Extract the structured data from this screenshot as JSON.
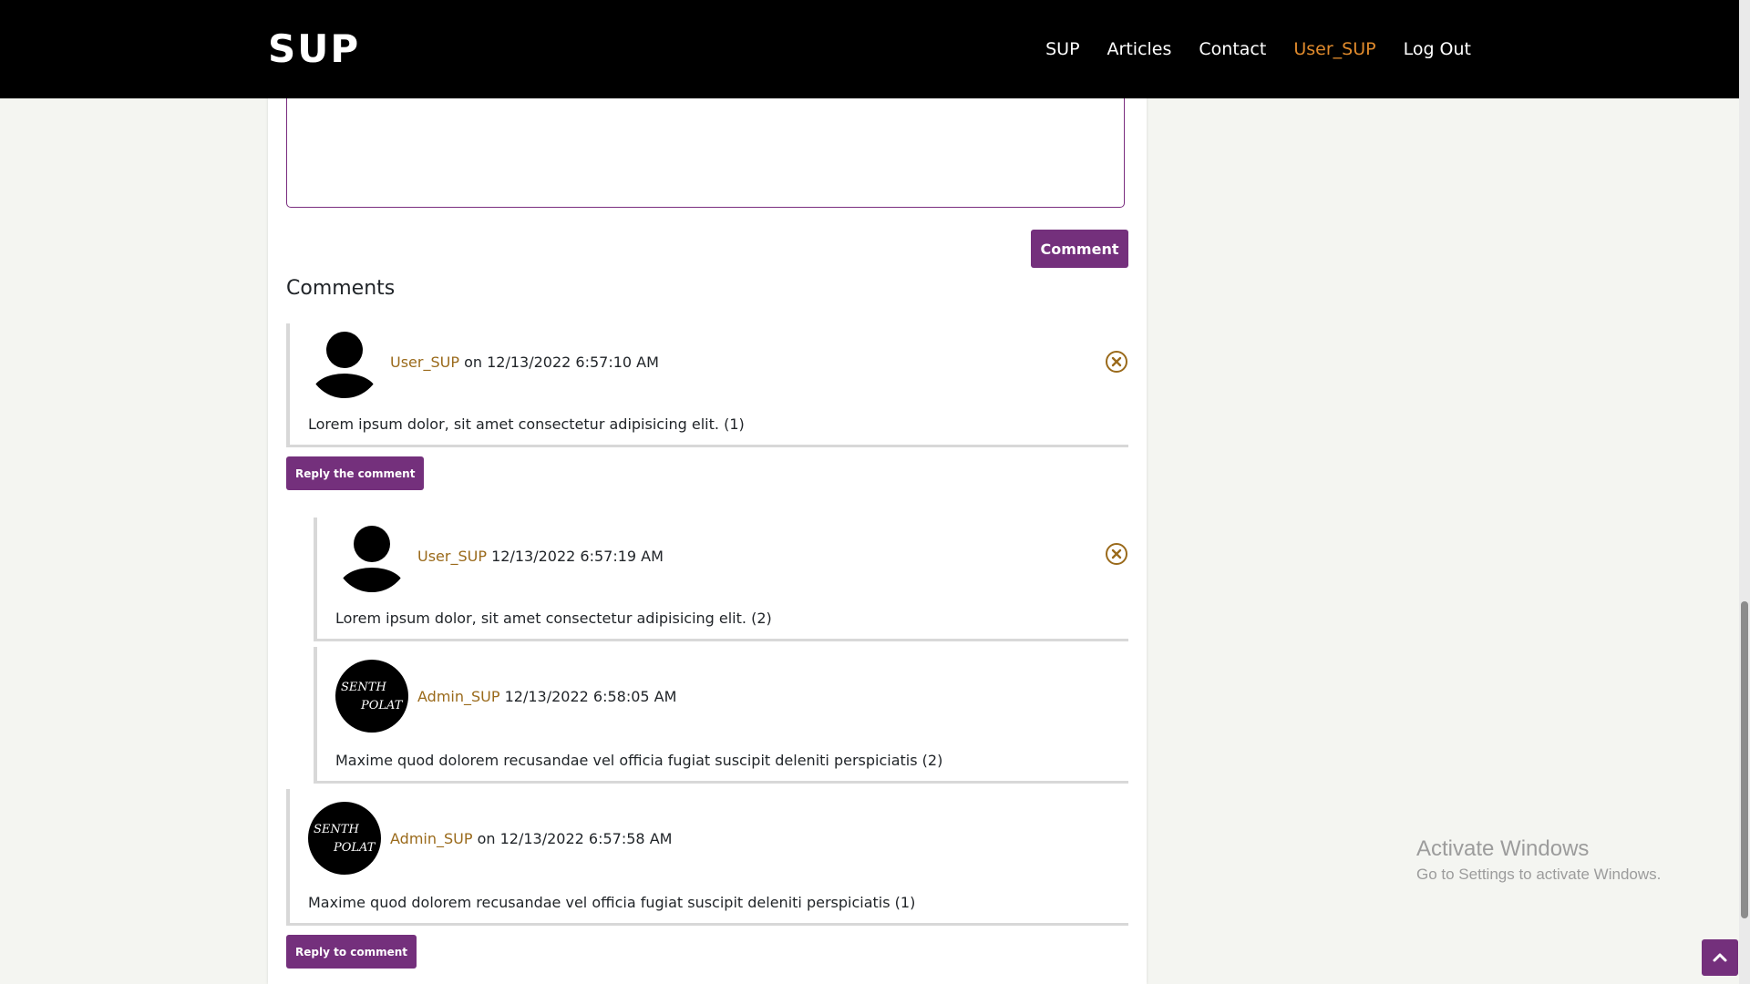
{
  "nav": {
    "brand": "SUP",
    "links": [
      "SUP",
      "Articles",
      "Contact",
      "User_SUP",
      "Log Out"
    ],
    "active_index": 3
  },
  "form": {
    "comment_button": "Comment"
  },
  "comments_title": "Comments",
  "comments": [
    {
      "author": "User_SUP",
      "date": "on 12/13/2022 6:57:10 AM",
      "text": "Lorem ipsum dolor, sit amet consectetur adipisicing elit. (1)",
      "reply_button": "Reply the comment",
      "avatar": "user-silhouette",
      "replies": [
        {
          "author": "User_SUP",
          "date": "12/13/2022 6:57:19 AM",
          "text": "Lorem ipsum dolor, sit amet consectetur adipisicing elit. (2)",
          "avatar": "user-silhouette"
        },
        {
          "author": "Admin_SUP",
          "date": "12/13/2022 6:58:05 AM",
          "text": "Maxime quod dolorem recusandae vel officia fugiat suscipit deleniti perspiciatis (2)",
          "avatar": "admin-logo"
        }
      ]
    },
    {
      "author": "Admin_SUP",
      "date": "on 12/13/2022 6:57:58 AM",
      "text": "Maxime quod dolorem recusandae vel officia fugiat suscipit deleniti perspiciatis (1)",
      "reply_button": "Reply to comment",
      "avatar": "admin-logo"
    }
  ],
  "watermark": {
    "title": "Activate Windows",
    "subtitle": "Go to Settings to activate Windows."
  },
  "colors": {
    "navbar": "#000000",
    "accent": "#74307c",
    "author": "#9a6a1b",
    "active_nav": "#e08a2c"
  }
}
